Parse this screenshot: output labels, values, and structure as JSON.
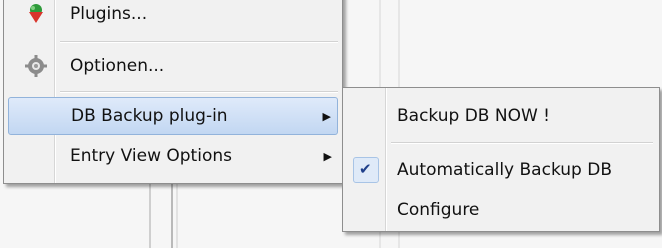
{
  "menu": {
    "items": [
      {
        "label": "Plugins...",
        "icon": "plugin-icon"
      },
      {
        "label": "Optionen...",
        "icon": "gear-icon"
      },
      {
        "label": "DB Backup plug-in",
        "has_submenu": true,
        "highlighted": true
      },
      {
        "label": "Entry View Options",
        "has_submenu": true
      }
    ],
    "submenu_arrow": "▶"
  },
  "submenu": {
    "items": [
      {
        "label": "Backup DB NOW !"
      },
      {
        "label": "Automatically Backup DB",
        "checked": true,
        "check_glyph": "✔"
      },
      {
        "label": "Configure"
      }
    ]
  },
  "colors": {
    "highlight_top": "#dfeafa",
    "highlight_bottom": "#c2d7f2",
    "highlight_border": "#92b3db",
    "check_color": "#1f3f8a"
  }
}
